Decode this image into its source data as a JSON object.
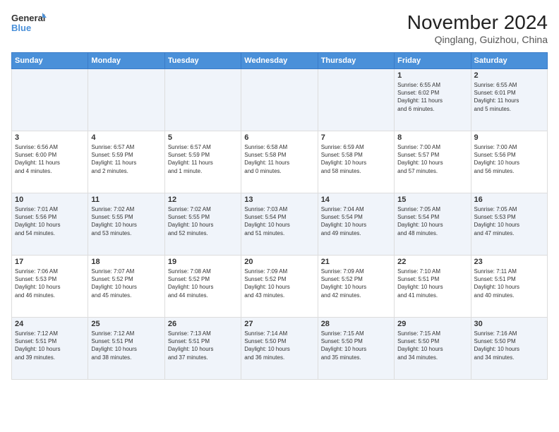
{
  "header": {
    "logo_line1": "General",
    "logo_line2": "Blue",
    "month": "November 2024",
    "location": "Qinglang, Guizhou, China"
  },
  "days_of_week": [
    "Sunday",
    "Monday",
    "Tuesday",
    "Wednesday",
    "Thursday",
    "Friday",
    "Saturday"
  ],
  "weeks": [
    [
      {
        "day": "",
        "text": ""
      },
      {
        "day": "",
        "text": ""
      },
      {
        "day": "",
        "text": ""
      },
      {
        "day": "",
        "text": ""
      },
      {
        "day": "",
        "text": ""
      },
      {
        "day": "1",
        "text": "Sunrise: 6:55 AM\nSunset: 6:02 PM\nDaylight: 11 hours\nand 6 minutes."
      },
      {
        "day": "2",
        "text": "Sunrise: 6:55 AM\nSunset: 6:01 PM\nDaylight: 11 hours\nand 5 minutes."
      }
    ],
    [
      {
        "day": "3",
        "text": "Sunrise: 6:56 AM\nSunset: 6:00 PM\nDaylight: 11 hours\nand 4 minutes."
      },
      {
        "day": "4",
        "text": "Sunrise: 6:57 AM\nSunset: 5:59 PM\nDaylight: 11 hours\nand 2 minutes."
      },
      {
        "day": "5",
        "text": "Sunrise: 6:57 AM\nSunset: 5:59 PM\nDaylight: 11 hours\nand 1 minute."
      },
      {
        "day": "6",
        "text": "Sunrise: 6:58 AM\nSunset: 5:58 PM\nDaylight: 11 hours\nand 0 minutes."
      },
      {
        "day": "7",
        "text": "Sunrise: 6:59 AM\nSunset: 5:58 PM\nDaylight: 10 hours\nand 58 minutes."
      },
      {
        "day": "8",
        "text": "Sunrise: 7:00 AM\nSunset: 5:57 PM\nDaylight: 10 hours\nand 57 minutes."
      },
      {
        "day": "9",
        "text": "Sunrise: 7:00 AM\nSunset: 5:56 PM\nDaylight: 10 hours\nand 56 minutes."
      }
    ],
    [
      {
        "day": "10",
        "text": "Sunrise: 7:01 AM\nSunset: 5:56 PM\nDaylight: 10 hours\nand 54 minutes."
      },
      {
        "day": "11",
        "text": "Sunrise: 7:02 AM\nSunset: 5:55 PM\nDaylight: 10 hours\nand 53 minutes."
      },
      {
        "day": "12",
        "text": "Sunrise: 7:02 AM\nSunset: 5:55 PM\nDaylight: 10 hours\nand 52 minutes."
      },
      {
        "day": "13",
        "text": "Sunrise: 7:03 AM\nSunset: 5:54 PM\nDaylight: 10 hours\nand 51 minutes."
      },
      {
        "day": "14",
        "text": "Sunrise: 7:04 AM\nSunset: 5:54 PM\nDaylight: 10 hours\nand 49 minutes."
      },
      {
        "day": "15",
        "text": "Sunrise: 7:05 AM\nSunset: 5:54 PM\nDaylight: 10 hours\nand 48 minutes."
      },
      {
        "day": "16",
        "text": "Sunrise: 7:05 AM\nSunset: 5:53 PM\nDaylight: 10 hours\nand 47 minutes."
      }
    ],
    [
      {
        "day": "17",
        "text": "Sunrise: 7:06 AM\nSunset: 5:53 PM\nDaylight: 10 hours\nand 46 minutes."
      },
      {
        "day": "18",
        "text": "Sunrise: 7:07 AM\nSunset: 5:52 PM\nDaylight: 10 hours\nand 45 minutes."
      },
      {
        "day": "19",
        "text": "Sunrise: 7:08 AM\nSunset: 5:52 PM\nDaylight: 10 hours\nand 44 minutes."
      },
      {
        "day": "20",
        "text": "Sunrise: 7:09 AM\nSunset: 5:52 PM\nDaylight: 10 hours\nand 43 minutes."
      },
      {
        "day": "21",
        "text": "Sunrise: 7:09 AM\nSunset: 5:52 PM\nDaylight: 10 hours\nand 42 minutes."
      },
      {
        "day": "22",
        "text": "Sunrise: 7:10 AM\nSunset: 5:51 PM\nDaylight: 10 hours\nand 41 minutes."
      },
      {
        "day": "23",
        "text": "Sunrise: 7:11 AM\nSunset: 5:51 PM\nDaylight: 10 hours\nand 40 minutes."
      }
    ],
    [
      {
        "day": "24",
        "text": "Sunrise: 7:12 AM\nSunset: 5:51 PM\nDaylight: 10 hours\nand 39 minutes."
      },
      {
        "day": "25",
        "text": "Sunrise: 7:12 AM\nSunset: 5:51 PM\nDaylight: 10 hours\nand 38 minutes."
      },
      {
        "day": "26",
        "text": "Sunrise: 7:13 AM\nSunset: 5:51 PM\nDaylight: 10 hours\nand 37 minutes."
      },
      {
        "day": "27",
        "text": "Sunrise: 7:14 AM\nSunset: 5:50 PM\nDaylight: 10 hours\nand 36 minutes."
      },
      {
        "day": "28",
        "text": "Sunrise: 7:15 AM\nSunset: 5:50 PM\nDaylight: 10 hours\nand 35 minutes."
      },
      {
        "day": "29",
        "text": "Sunrise: 7:15 AM\nSunset: 5:50 PM\nDaylight: 10 hours\nand 34 minutes."
      },
      {
        "day": "30",
        "text": "Sunrise: 7:16 AM\nSunset: 5:50 PM\nDaylight: 10 hours\nand 34 minutes."
      }
    ]
  ],
  "alt_rows": [
    0,
    2,
    4
  ]
}
